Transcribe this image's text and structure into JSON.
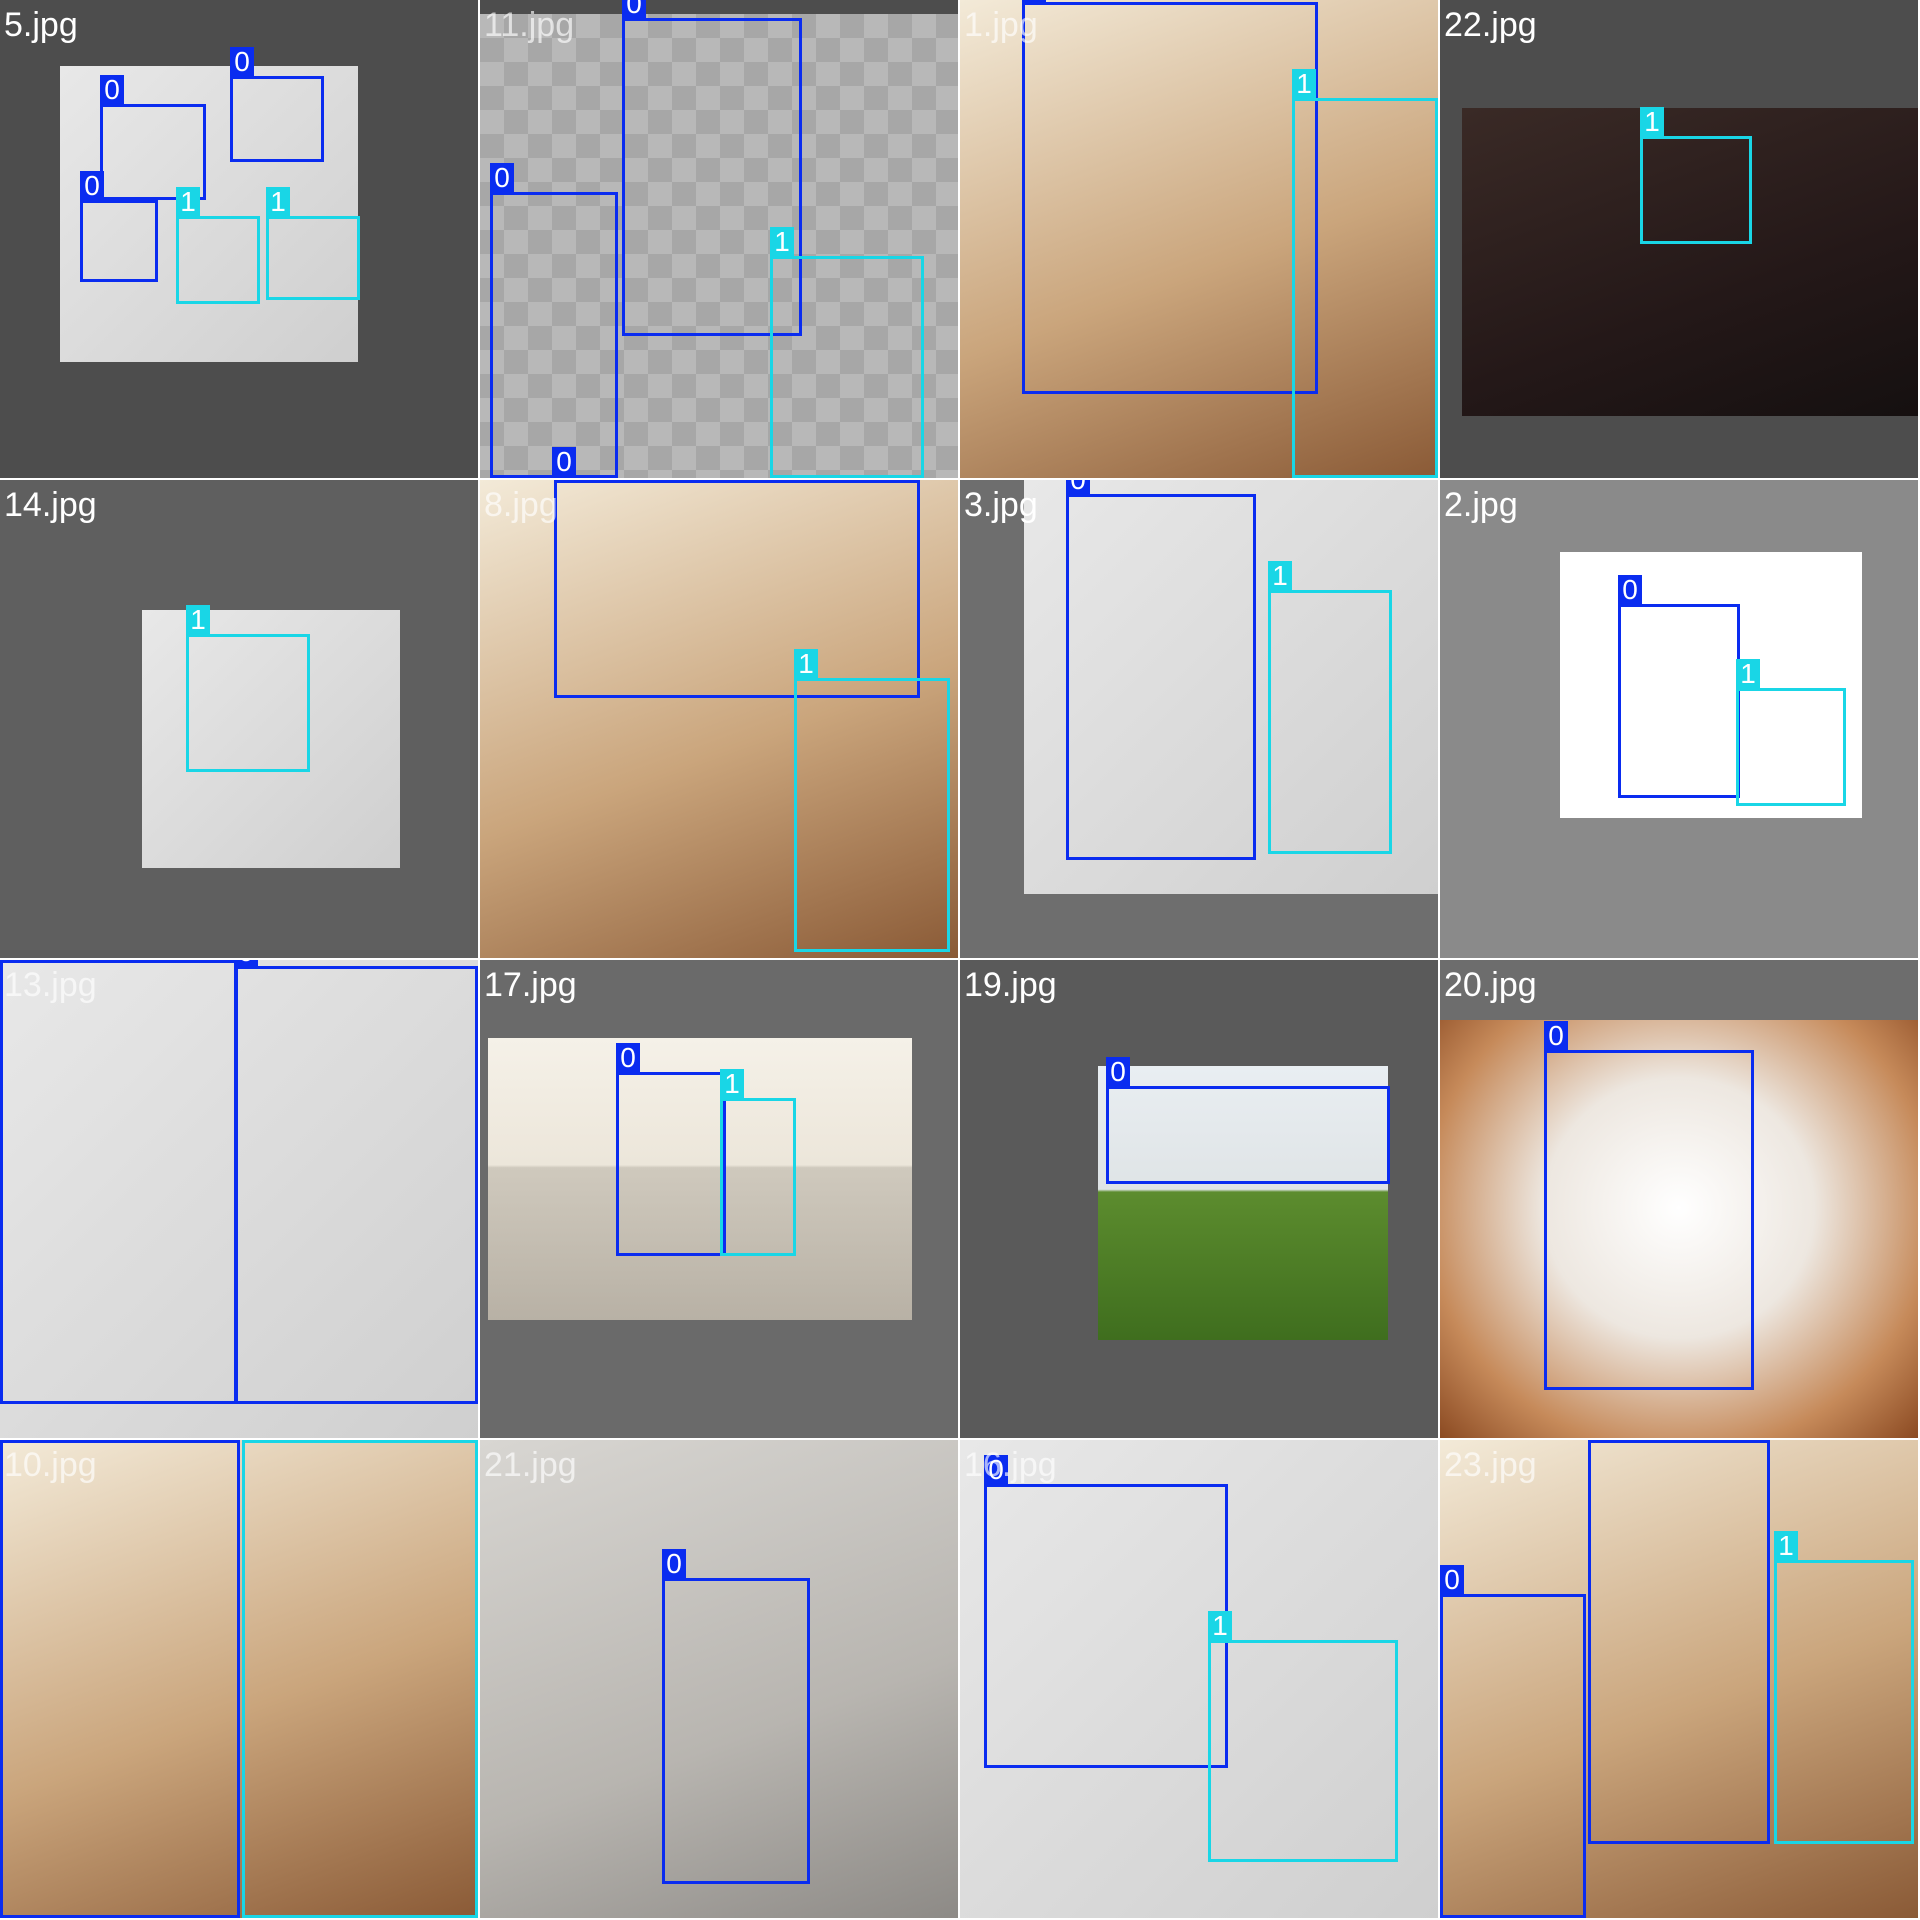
{
  "colors": {
    "class_0": "#0a2cf0",
    "class_1": "#19d6e6"
  },
  "tiles": [
    {
      "name": "5.jpg",
      "bg": "#4d4d4d",
      "photo": "light",
      "labels": [
        "0",
        "0",
        "0",
        "1",
        "1"
      ]
    },
    {
      "name": "11.jpg",
      "bg": "#4d4d4d",
      "photo": "checker",
      "labels": [
        "0",
        "0",
        "0",
        "1"
      ]
    },
    {
      "name": "1.jpg",
      "bg": "#4d4d4d",
      "photo": "warm",
      "labels": [
        "0",
        "1"
      ]
    },
    {
      "name": "22.jpg",
      "bg": "#4d4d4d",
      "photo": "dark",
      "labels": [
        "1"
      ]
    },
    {
      "name": "14.jpg",
      "bg": "#5f5f5f",
      "photo": "light",
      "labels": [
        "1"
      ]
    },
    {
      "name": "8.jpg",
      "bg": "#ffffff",
      "photo": "warm",
      "labels": [
        "0",
        "1"
      ]
    },
    {
      "name": "3.jpg",
      "bg": "#6e6e6e",
      "photo": "light",
      "labels": [
        "0",
        "1"
      ]
    },
    {
      "name": "2.jpg",
      "bg": "#8a8a8a",
      "photo": "white",
      "labels": [
        "0",
        "1"
      ]
    },
    {
      "name": "13.jpg",
      "bg": "#555555",
      "photo": "light",
      "labels": [
        "0",
        "0"
      ]
    },
    {
      "name": "17.jpg",
      "bg": "#6a6a6a",
      "photo": "room",
      "labels": [
        "0",
        "1"
      ]
    },
    {
      "name": "19.jpg",
      "bg": "#5a5a5a",
      "photo": "grass",
      "labels": [
        "0"
      ]
    },
    {
      "name": "20.jpg",
      "bg": "#6d6d6d",
      "photo": "fluffy",
      "labels": [
        "0"
      ]
    },
    {
      "name": "10.jpg",
      "bg": "#ffffff",
      "photo": "warm",
      "labels": [
        "0",
        "1"
      ]
    },
    {
      "name": "21.jpg",
      "bg": "#9a9a9a",
      "photo": "floor",
      "labels": [
        "0"
      ]
    },
    {
      "name": "16.jpg",
      "bg": "#a0a0a0",
      "photo": "light",
      "labels": [
        "0",
        "1"
      ]
    },
    {
      "name": "23.jpg",
      "bg": "#ffffff",
      "photo": "warm",
      "labels": [
        "0",
        "0",
        "1"
      ]
    }
  ]
}
